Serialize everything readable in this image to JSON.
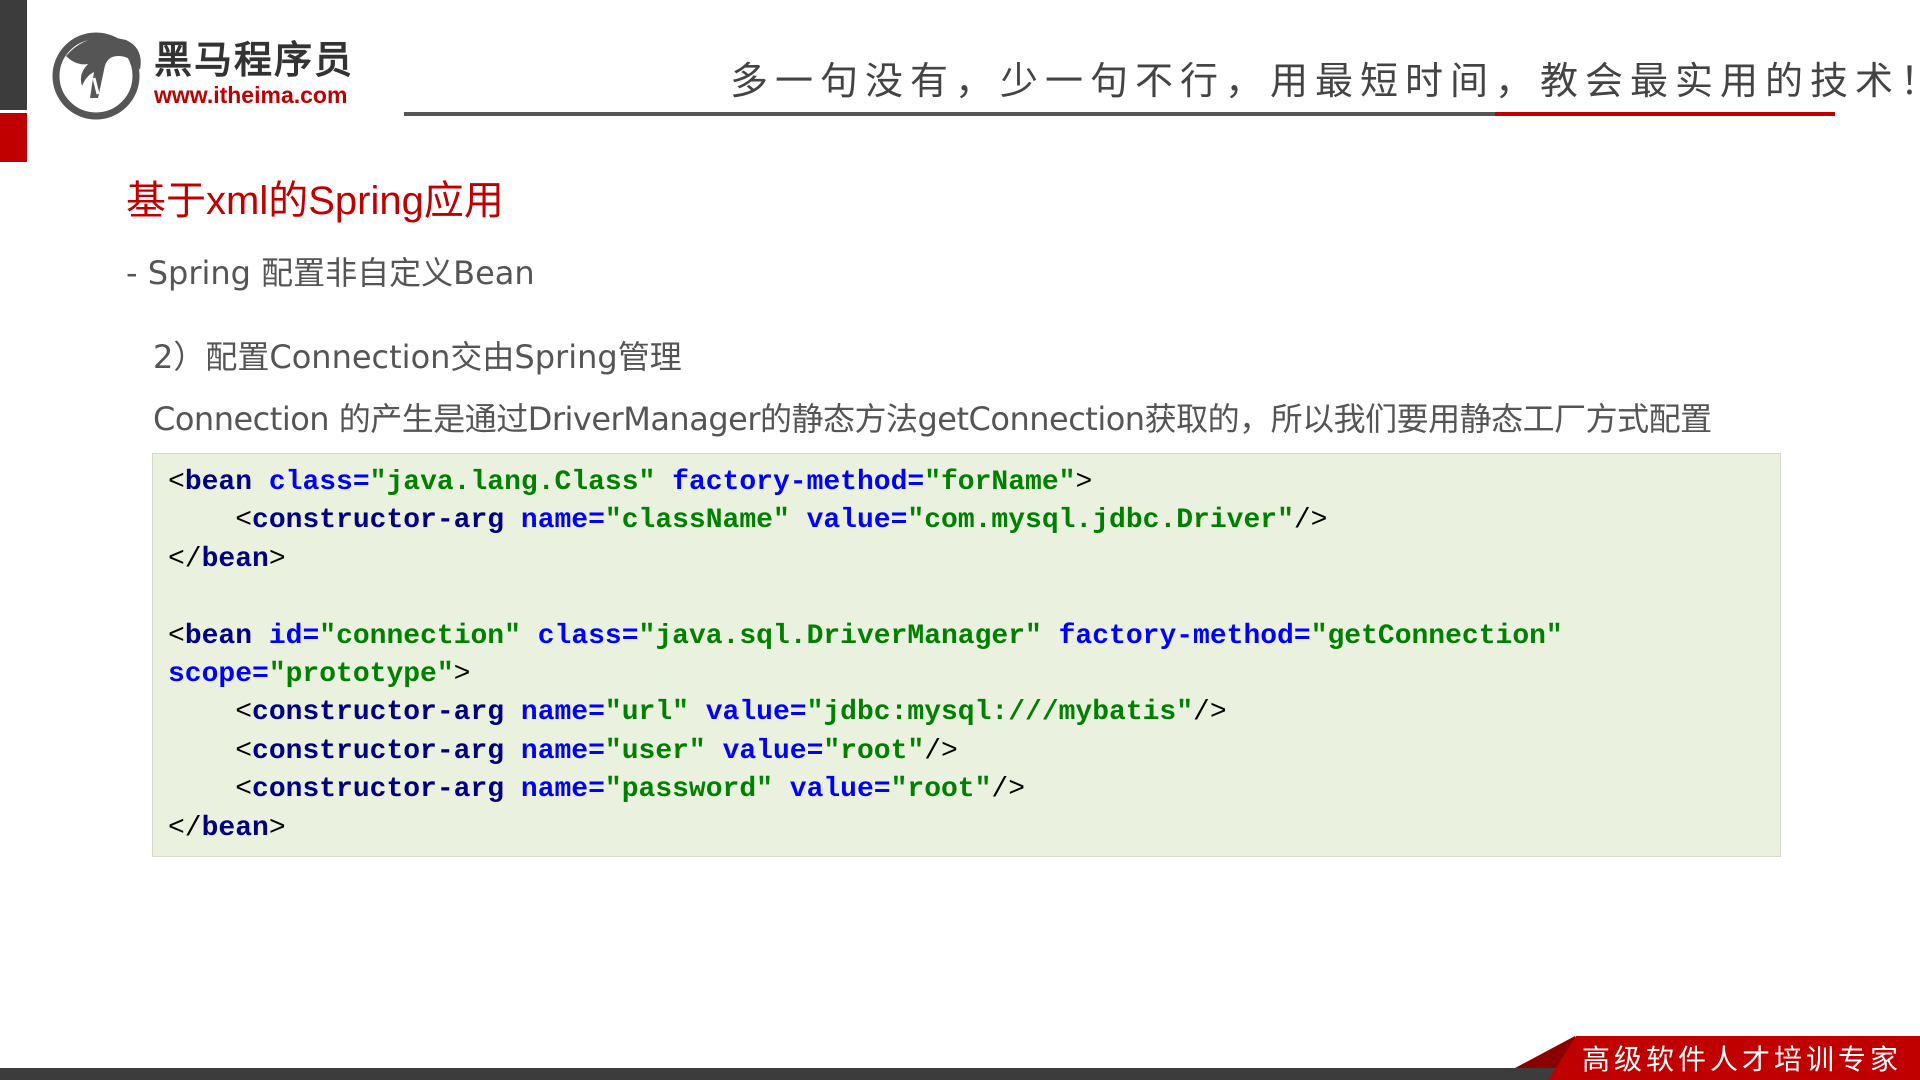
{
  "header": {
    "logo_cn": "黑马程序员",
    "logo_url": "www.itheima.com",
    "slogan": "多一句没有，少一句不行，用最短时间，教会最实用的技术！"
  },
  "colors": {
    "accent": "#c00000",
    "dark": "#3c3c3c",
    "code_bg": "#eaf1de",
    "tag": "#000080",
    "attr": "#0000ff",
    "value": "#008000"
  },
  "slide": {
    "title": "基于xml的Spring应用",
    "subtitle": "- Spring 配置非自定义Bean",
    "step": "2）配置Connection交由Spring管理",
    "description": "Connection 的产生是通过DriverManager的静态方法getConnection获取的，所以我们要用静态工厂方式配置"
  },
  "code": [
    [
      [
        "b",
        "<"
      ],
      [
        "g",
        "bean"
      ],
      [
        "s",
        " "
      ],
      [
        "a",
        "class"
      ],
      [
        "e",
        "="
      ],
      [
        "v",
        "\"java.lang.Class\""
      ],
      [
        "s",
        " "
      ],
      [
        "a",
        "factory-method"
      ],
      [
        "e",
        "="
      ],
      [
        "v",
        "\"forName\""
      ],
      [
        "b",
        ">"
      ]
    ],
    [
      [
        "s",
        "    "
      ],
      [
        "b",
        "<"
      ],
      [
        "g",
        "constructor-arg"
      ],
      [
        "s",
        " "
      ],
      [
        "a",
        "name"
      ],
      [
        "e",
        "="
      ],
      [
        "v",
        "\"className\""
      ],
      [
        "s",
        " "
      ],
      [
        "a",
        "value"
      ],
      [
        "e",
        "="
      ],
      [
        "v",
        "\"com.mysql.jdbc.Driver\""
      ],
      [
        "b",
        "/>"
      ]
    ],
    [
      [
        "b",
        "</"
      ],
      [
        "g",
        "bean"
      ],
      [
        "b",
        ">"
      ]
    ],
    [],
    [
      [
        "b",
        "<"
      ],
      [
        "g",
        "bean"
      ],
      [
        "s",
        " "
      ],
      [
        "a",
        "id"
      ],
      [
        "e",
        "="
      ],
      [
        "v",
        "\"connection\""
      ],
      [
        "s",
        " "
      ],
      [
        "a",
        "class"
      ],
      [
        "e",
        "="
      ],
      [
        "v",
        "\"java.sql.DriverManager\""
      ],
      [
        "s",
        " "
      ],
      [
        "a",
        "factory-method"
      ],
      [
        "e",
        "="
      ],
      [
        "v",
        "\"getConnection\""
      ]
    ],
    [
      [
        "a",
        "scope"
      ],
      [
        "e",
        "="
      ],
      [
        "v",
        "\"prototype\""
      ],
      [
        "b",
        ">"
      ]
    ],
    [
      [
        "s",
        "    "
      ],
      [
        "b",
        "<"
      ],
      [
        "g",
        "constructor-arg"
      ],
      [
        "s",
        " "
      ],
      [
        "a",
        "name"
      ],
      [
        "e",
        "="
      ],
      [
        "v",
        "\"url\""
      ],
      [
        "s",
        " "
      ],
      [
        "a",
        "value"
      ],
      [
        "e",
        "="
      ],
      [
        "v",
        "\"jdbc:mysql:///mybatis\""
      ],
      [
        "b",
        "/>"
      ]
    ],
    [
      [
        "s",
        "    "
      ],
      [
        "b",
        "<"
      ],
      [
        "g",
        "constructor-arg"
      ],
      [
        "s",
        " "
      ],
      [
        "a",
        "name"
      ],
      [
        "e",
        "="
      ],
      [
        "v",
        "\"user\""
      ],
      [
        "s",
        " "
      ],
      [
        "a",
        "value"
      ],
      [
        "e",
        "="
      ],
      [
        "v",
        "\"root\""
      ],
      [
        "b",
        "/>"
      ]
    ],
    [
      [
        "s",
        "    "
      ],
      [
        "b",
        "<"
      ],
      [
        "g",
        "constructor-arg"
      ],
      [
        "s",
        " "
      ],
      [
        "a",
        "name"
      ],
      [
        "e",
        "="
      ],
      [
        "v",
        "\"password\""
      ],
      [
        "s",
        " "
      ],
      [
        "a",
        "value"
      ],
      [
        "e",
        "="
      ],
      [
        "v",
        "\"root\""
      ],
      [
        "b",
        "/>"
      ]
    ],
    [
      [
        "b",
        "</"
      ],
      [
        "g",
        "bean"
      ],
      [
        "b",
        ">"
      ]
    ]
  ],
  "footer": {
    "tagline": "高级软件人才培训专家"
  }
}
